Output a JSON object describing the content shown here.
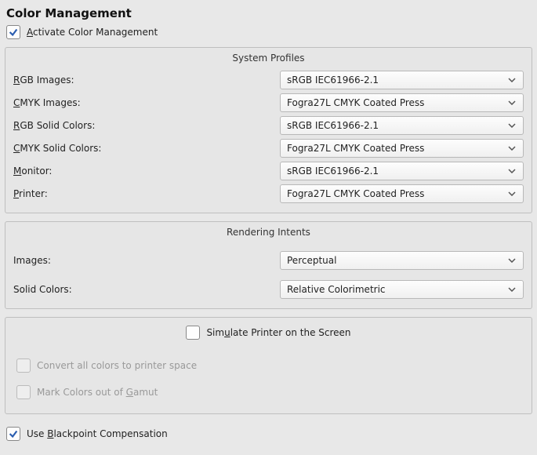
{
  "title": "Color Management",
  "activate": {
    "prefix": "A",
    "rest": "ctivate Color Management",
    "checked": true
  },
  "system_profiles": {
    "title": "System Profiles",
    "rows": [
      {
        "label_prefix": "R",
        "label_rest": "GB Images:",
        "value": "sRGB IEC61966-2.1"
      },
      {
        "label_prefix": "C",
        "label_rest": "MYK Images:",
        "value": "Fogra27L CMYK Coated Press"
      },
      {
        "label_prefix": "R",
        "label_rest": "GB Solid Colors:",
        "value": "sRGB IEC61966-2.1"
      },
      {
        "label_prefix": "C",
        "label_rest": "MYK Solid Colors:",
        "value": "Fogra27L CMYK Coated Press"
      },
      {
        "label_prefix": "M",
        "label_rest": "onitor:",
        "value": "sRGB IEC61966-2.1"
      },
      {
        "label_prefix": "P",
        "label_rest": "rinter:",
        "value": "Fogra27L CMYK Coated Press"
      }
    ]
  },
  "rendering_intents": {
    "title": "Rendering Intents",
    "rows": [
      {
        "label": "Images:",
        "value": "Perceptual"
      },
      {
        "label": "Solid Colors:",
        "value": "Relative Colorimetric"
      }
    ]
  },
  "printer_sim": {
    "simulate": {
      "prefix": "u",
      "pre": "Sim",
      "rest": "late Printer on the Screen",
      "checked": false
    },
    "convert": {
      "label": "Convert all colors to printer space",
      "checked": false,
      "disabled": true
    },
    "gamut": {
      "pre": "Mark Colors out of ",
      "prefix": "G",
      "rest": "amut",
      "checked": false,
      "disabled": true
    }
  },
  "blackpoint": {
    "pre": "Use ",
    "prefix": "B",
    "rest": "lackpoint Compensation",
    "checked": true
  }
}
